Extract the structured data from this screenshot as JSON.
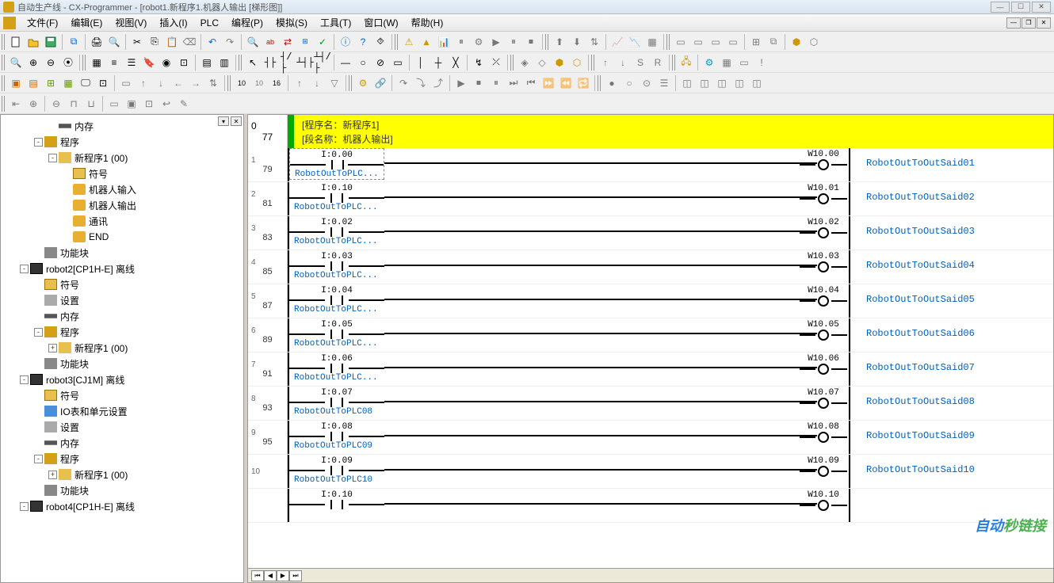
{
  "title": "自动生产线 - CX-Programmer - [robot1.新程序1.机器人输出 [梯形图]]",
  "menu": [
    "文件(F)",
    "编辑(E)",
    "视图(V)",
    "插入(I)",
    "PLC",
    "编程(P)",
    "模拟(S)",
    "工具(T)",
    "窗口(W)",
    "帮助(H)"
  ],
  "banner": {
    "program": "[程序名：新程序1]",
    "section": "[段名称：机器人输出]"
  },
  "tree": [
    {
      "indent": 3,
      "exp": "",
      "icon": "ic-mem",
      "label": "内存"
    },
    {
      "indent": 2,
      "exp": "-",
      "icon": "ic-prog",
      "label": "程序"
    },
    {
      "indent": 3,
      "exp": "-",
      "icon": "ic-newprog",
      "label": "新程序1 (00)"
    },
    {
      "indent": 4,
      "exp": "",
      "icon": "ic-sym",
      "label": "符号"
    },
    {
      "indent": 4,
      "exp": "",
      "icon": "ic-sect",
      "label": "机器人输入"
    },
    {
      "indent": 4,
      "exp": "",
      "icon": "ic-sect",
      "label": "机器人输出"
    },
    {
      "indent": 4,
      "exp": "",
      "icon": "ic-sect",
      "label": "通讯"
    },
    {
      "indent": 4,
      "exp": "",
      "icon": "ic-sect",
      "label": "END"
    },
    {
      "indent": 2,
      "exp": "",
      "icon": "ic-func",
      "label": "功能块"
    },
    {
      "indent": 1,
      "exp": "-",
      "icon": "ic-plc",
      "label": "robot2[CP1H-E] 离线"
    },
    {
      "indent": 2,
      "exp": "",
      "icon": "ic-sym",
      "label": "符号"
    },
    {
      "indent": 2,
      "exp": "",
      "icon": "ic-set",
      "label": "设置"
    },
    {
      "indent": 2,
      "exp": "",
      "icon": "ic-mem",
      "label": "内存"
    },
    {
      "indent": 2,
      "exp": "-",
      "icon": "ic-prog",
      "label": "程序"
    },
    {
      "indent": 3,
      "exp": "+",
      "icon": "ic-newprog",
      "label": "新程序1 (00)"
    },
    {
      "indent": 2,
      "exp": "",
      "icon": "ic-func",
      "label": "功能块"
    },
    {
      "indent": 1,
      "exp": "-",
      "icon": "ic-plc",
      "label": "robot3[CJ1M] 离线"
    },
    {
      "indent": 2,
      "exp": "",
      "icon": "ic-sym",
      "label": "符号"
    },
    {
      "indent": 2,
      "exp": "",
      "icon": "ic-io",
      "label": "IO表和单元设置"
    },
    {
      "indent": 2,
      "exp": "",
      "icon": "ic-set",
      "label": "设置"
    },
    {
      "indent": 2,
      "exp": "",
      "icon": "ic-mem",
      "label": "内存"
    },
    {
      "indent": 2,
      "exp": "-",
      "icon": "ic-prog",
      "label": "程序"
    },
    {
      "indent": 3,
      "exp": "+",
      "icon": "ic-newprog",
      "label": "新程序1 (00)"
    },
    {
      "indent": 2,
      "exp": "",
      "icon": "ic-func",
      "label": "功能块"
    },
    {
      "indent": 1,
      "exp": "-",
      "icon": "ic-plc",
      "label": "robot4[CP1H-E] 离线"
    }
  ],
  "header_gutter": {
    "rung": "0",
    "line": "77"
  },
  "rungs": [
    {
      "rung": "1",
      "line": "79",
      "input": "I:0.00",
      "label": "RobotOutToPLC...",
      "coil": "W10.00",
      "comment": "RobotOutToOutSaid01",
      "dashed": true,
      "topShift": true
    },
    {
      "rung": "2",
      "line": "81",
      "input": "I:0.10",
      "label": "RobotOutToPLC...",
      "coil": "W10.01",
      "comment": "RobotOutToOutSaid02"
    },
    {
      "rung": "3",
      "line": "83",
      "input": "I:0.02",
      "label": "RobotOutToPLC...",
      "coil": "W10.02",
      "comment": "RobotOutToOutSaid03"
    },
    {
      "rung": "4",
      "line": "85",
      "input": "I:0.03",
      "label": "RobotOutToPLC...",
      "coil": "W10.03",
      "comment": "RobotOutToOutSaid04"
    },
    {
      "rung": "5",
      "line": "87",
      "input": "I:0.04",
      "label": "RobotOutToPLC...",
      "coil": "W10.04",
      "comment": "RobotOutToOutSaid05"
    },
    {
      "rung": "6",
      "line": "89",
      "input": "I:0.05",
      "label": "RobotOutToPLC...",
      "coil": "W10.05",
      "comment": "RobotOutToOutSaid06"
    },
    {
      "rung": "7",
      "line": "91",
      "input": "I:0.06",
      "label": "RobotOutToPLC...",
      "coil": "W10.06",
      "comment": "RobotOutToOutSaid07"
    },
    {
      "rung": "8",
      "line": "93",
      "input": "I:0.07",
      "label": "RobotOutToPLC08",
      "coil": "W10.07",
      "comment": "RobotOutToOutSaid08"
    },
    {
      "rung": "9",
      "line": "95",
      "input": "I:0.08",
      "label": "RobotOutToPLC09",
      "coil": "W10.08",
      "comment": "RobotOutToOutSaid09"
    },
    {
      "rung": "10",
      "line": "",
      "input": "I:0.09",
      "label": "RobotOutToPLC10",
      "coil": "W10.09",
      "comment": "RobotOutToOutSaid10"
    },
    {
      "rung": "",
      "line": "",
      "input": "I:0.10",
      "label": "",
      "coil": "W10.10",
      "comment": ""
    }
  ],
  "watermark": {
    "t1": "自动",
    "t2": "秒链接"
  }
}
